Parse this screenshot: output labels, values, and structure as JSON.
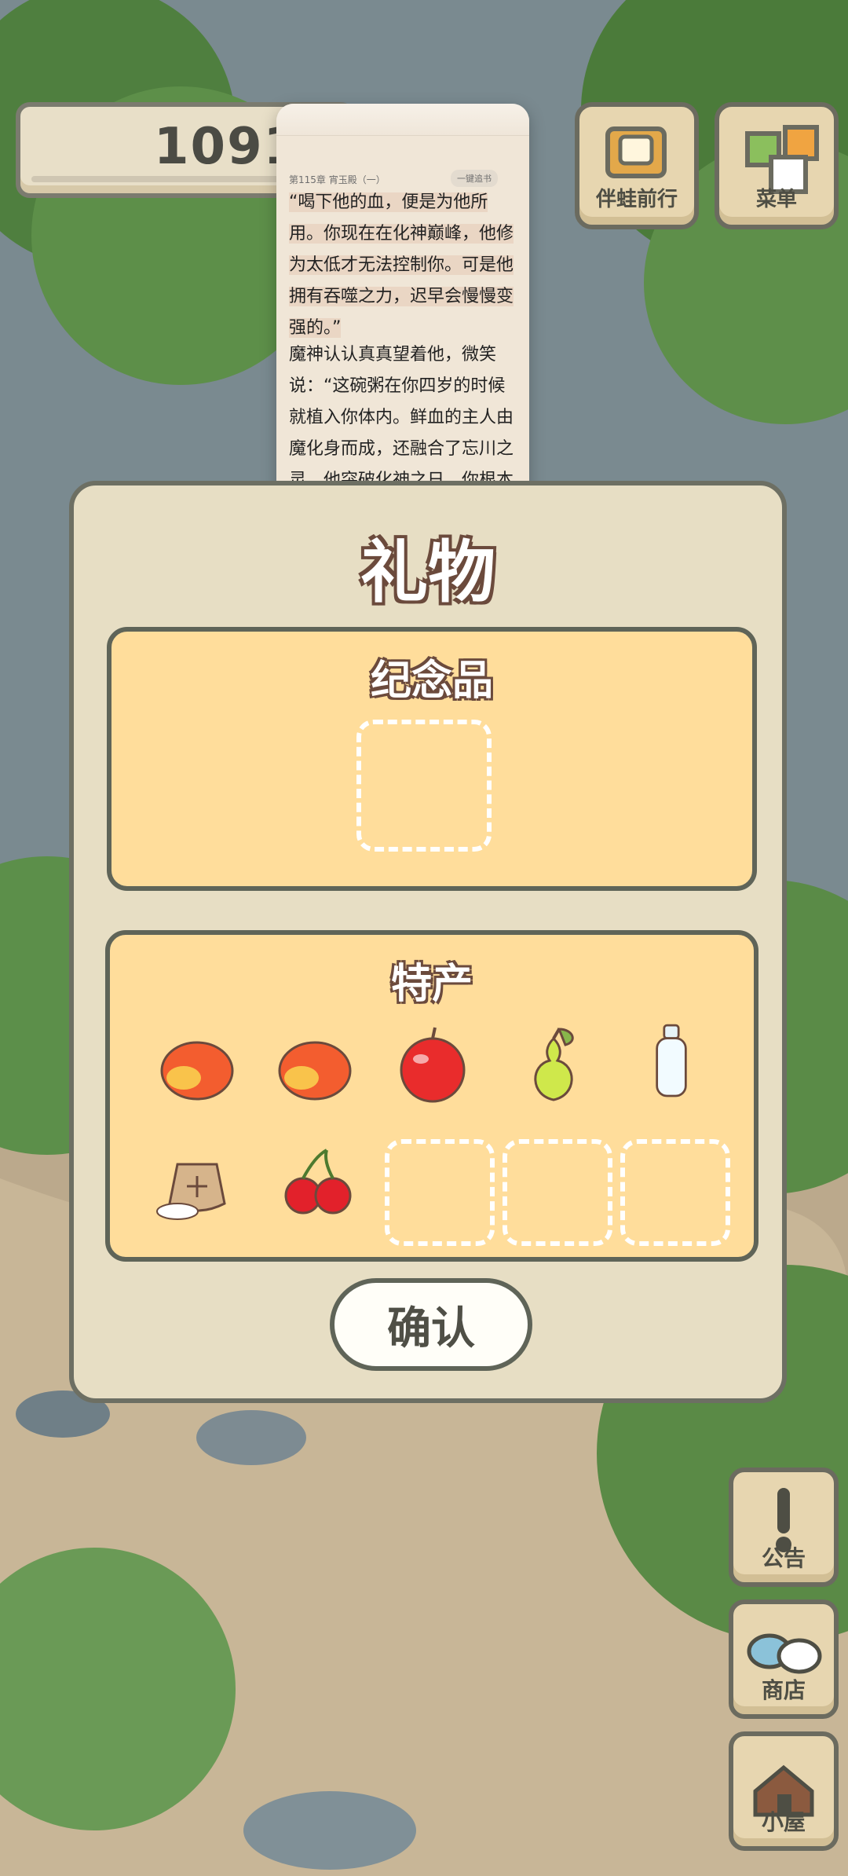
{
  "counter": {
    "value": "1091"
  },
  "top_buttons": [
    {
      "label": "伴蛙前行"
    },
    {
      "label": "菜单"
    }
  ],
  "side_buttons": [
    {
      "label": "公告"
    },
    {
      "label": "商店"
    },
    {
      "label": "小屋"
    }
  ],
  "reader": {
    "chapter": "第115章 宵玉殿（一）",
    "badge": "一键追书",
    "paragraphs": [
      "“喝下他的血，便是为他所用。你现在在化神巅峰，他修为太低才无法控制你。可是他拥有吞噬之力，迟早会慢慢变强的。”",
      "魔神认认真真望着他，微笑说：“这碗粥在你四岁的时候就植入你体内。鲜血的主人由魔化身而成，还融合了忘川之灵。他突破化神之日，你根本"
    ]
  },
  "gift": {
    "title": "礼物",
    "souvenir": {
      "header": "纪念品"
    },
    "specialty": {
      "header": "特产"
    },
    "confirm": "确认"
  },
  "colors": {
    "panel_bg": "#e7dec4",
    "box_bg": "#ffdd9b",
    "outline": "#5f6458"
  }
}
